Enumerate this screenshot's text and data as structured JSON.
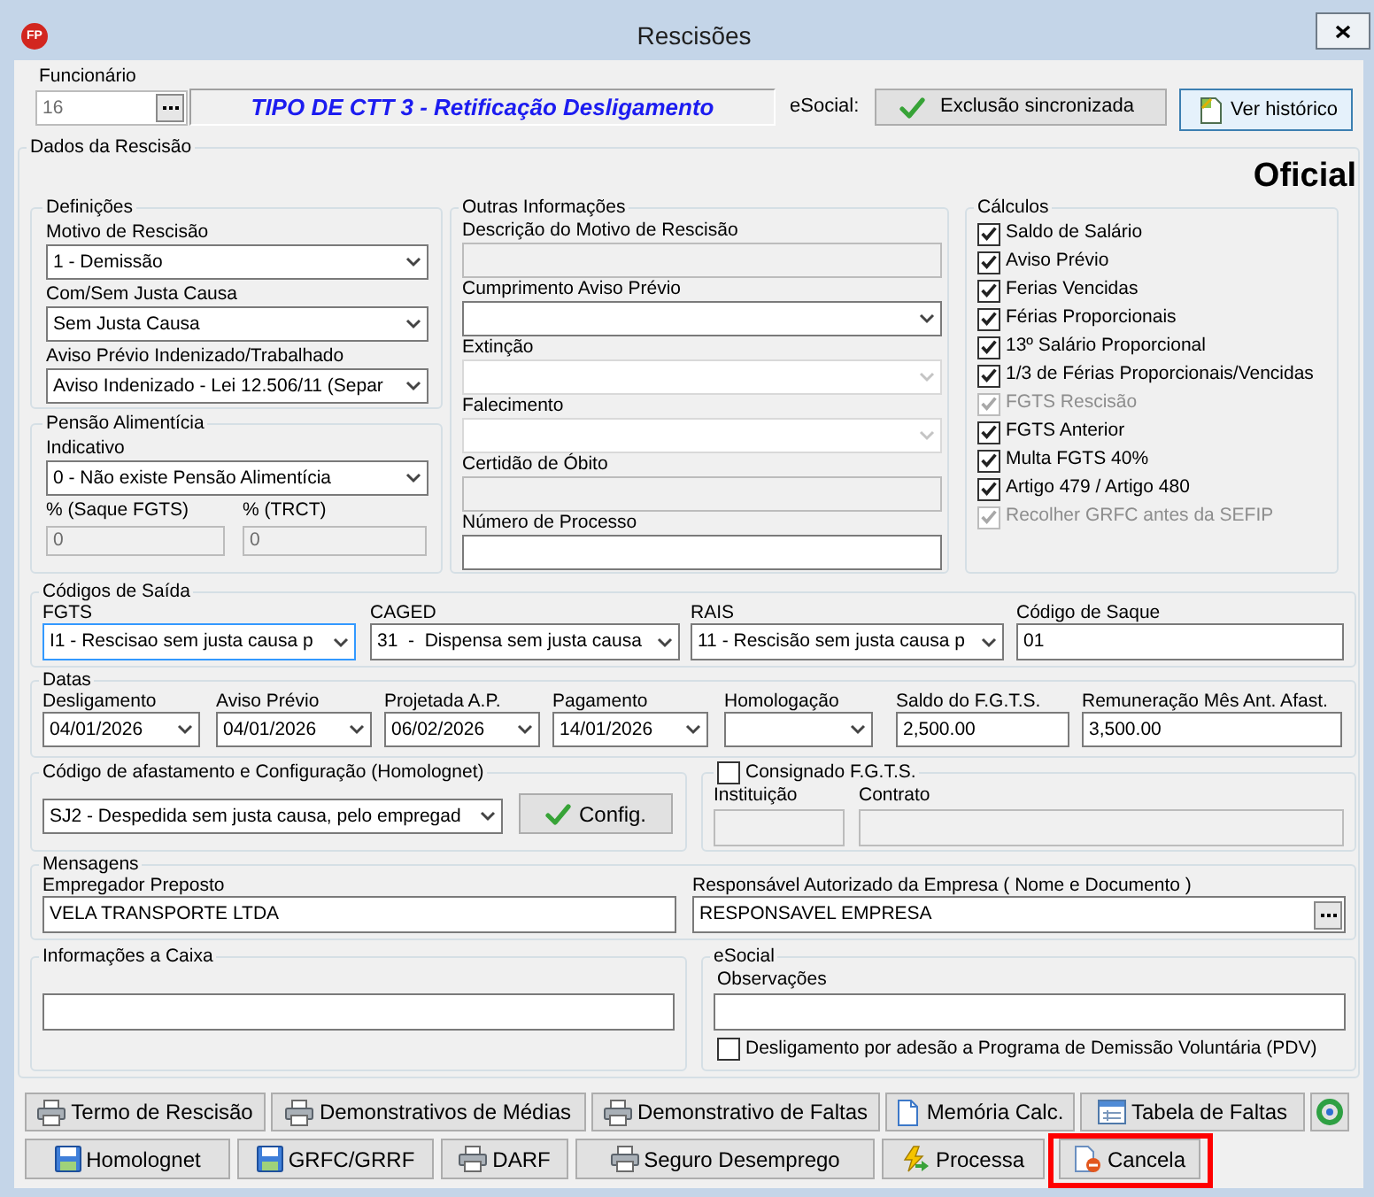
{
  "window": {
    "logo": "FP",
    "title": "Rescisões"
  },
  "employee": {
    "label": "Funcionário",
    "code": {
      "kind": "lookup",
      "value": "16",
      "disabled": true
    },
    "name": "TIPO DE CTT 3 - Retificação Desligamento"
  },
  "esocial_bar": {
    "label": "eSocial:",
    "buttons": [
      {
        "label": "Exclusão sincronizada",
        "focused": false
      },
      {
        "label": "Ver histórico",
        "focused": true
      }
    ]
  },
  "dados": {
    "title": "Dados da Rescisão",
    "status": "Oficial"
  },
  "definicoes": {
    "title": "Definições",
    "fields": [
      {
        "label": "Motivo de Rescisão",
        "kind": "select",
        "value": "1 - Demissão",
        "disabled": false
      },
      {
        "label": "Com/Sem Justa Causa",
        "kind": "select",
        "value": "Sem Justa Causa",
        "disabled": false
      },
      {
        "label": "Aviso Prévio Indenizado/Trabalhado",
        "kind": "select",
        "value": "Aviso Indenizado - Lei 12.506/11 (Separ",
        "disabled": false
      }
    ]
  },
  "pensao": {
    "title": "Pensão Alimentícia",
    "fields": [
      {
        "label": "Indicativo",
        "kind": "select",
        "value": "0 - Não existe Pensão Alimentícia",
        "disabled": false
      },
      {
        "label": "% (Saque FGTS)",
        "kind": "input",
        "value": "0",
        "disabled": true
      },
      {
        "label": "% (TRCT)",
        "kind": "input",
        "value": "0",
        "disabled": true
      }
    ]
  },
  "outras": {
    "title": "Outras Informações",
    "fields": [
      {
        "label": "Descrição do Motivo de Rescisão",
        "kind": "input",
        "disabled": true
      },
      {
        "label": "Cumprimento Aviso Prévio",
        "kind": "select",
        "disabled": false
      },
      {
        "label": "Extinção",
        "kind": "select",
        "disabled": true
      },
      {
        "label": "Falecimento",
        "kind": "select",
        "disabled": true
      },
      {
        "label": "Certidão de Óbito",
        "kind": "input",
        "disabled": true
      },
      {
        "label": "Número de Processo",
        "kind": "input",
        "disabled": false
      }
    ]
  },
  "calculos": {
    "title": "Cálculos",
    "items": [
      {
        "label": "Saldo de Salário",
        "checked": true,
        "disabled": false
      },
      {
        "label": "Aviso Prévio",
        "checked": true,
        "disabled": false
      },
      {
        "label": "Ferias Vencidas",
        "checked": true,
        "disabled": false
      },
      {
        "label": "Férias Proporcionais",
        "checked": true,
        "disabled": false
      },
      {
        "label": "13º Salário Proporcional",
        "checked": true,
        "disabled": false
      },
      {
        "label": "1/3 de Férias Proporcionais/Vencidas",
        "checked": true,
        "disabled": false
      },
      {
        "label": "FGTS Rescisão",
        "checked": true,
        "disabled": true
      },
      {
        "label": "FGTS Anterior",
        "checked": true,
        "disabled": false
      },
      {
        "label": "Multa FGTS 40%",
        "checked": true,
        "disabled": false
      },
      {
        "label": "Artigo 479 / Artigo 480",
        "checked": true,
        "disabled": false
      },
      {
        "label": "Recolher GRFC antes da SEFIP",
        "checked": true,
        "disabled": true
      }
    ]
  },
  "codigos_saida": {
    "title": "Códigos de Saída",
    "fields": [
      {
        "label": "FGTS",
        "kind": "select",
        "value": "I1 - Rescisao sem justa causa p",
        "focused": true
      },
      {
        "label": "CAGED",
        "kind": "select",
        "value": "31  -  Dispensa sem justa causa",
        "focused": false
      },
      {
        "label": "RAIS",
        "kind": "select",
        "value": "11 - Rescisão sem justa causa p",
        "focused": false
      },
      {
        "label": "Código de Saque",
        "kind": "input",
        "value": "01",
        "focused": false
      }
    ]
  },
  "datas": {
    "title": "Datas",
    "fields": [
      {
        "label": "Desligamento",
        "kind": "date",
        "value": "04/01/2026"
      },
      {
        "label": "Aviso Prévio",
        "kind": "date",
        "value": "04/01/2026"
      },
      {
        "label": "Projetada A.P.",
        "kind": "date",
        "value": "06/02/2026"
      },
      {
        "label": "Pagamento",
        "kind": "date",
        "value": "14/01/2026"
      },
      {
        "label": "Homologação",
        "kind": "date"
      },
      {
        "label": "Saldo do F.G.T.S.",
        "kind": "input",
        "value": "2,500.00"
      },
      {
        "label": "Remuneração Mês Ant. Afast.",
        "kind": "input",
        "value": "3,500.00"
      }
    ]
  },
  "afastamento": {
    "title": "Código de afastamento e Configuração (Homolognet)",
    "field": {
      "kind": "select",
      "value": "SJ2 - Despedida sem justa causa, pelo empregad"
    },
    "button": "Config."
  },
  "consignado": {
    "label": "Consignado F.G.T.S.",
    "checked": false,
    "fields": [
      {
        "label": "Instituição",
        "kind": "input",
        "disabled": true
      },
      {
        "label": "Contrato",
        "kind": "input",
        "disabled": true
      }
    ]
  },
  "mensagens": {
    "title": "Mensagens",
    "fields": [
      {
        "label": "Empregador Preposto",
        "kind": "input",
        "value": "VELA TRANSPORTE LTDA"
      },
      {
        "label": "Responsável Autorizado da Empresa ( Nome e Documento )",
        "kind": "lookup",
        "value": "RESPONSAVEL EMPRESA"
      }
    ]
  },
  "informacoes_caixa": {
    "title": "Informações a Caixa",
    "field": {
      "kind": "input"
    }
  },
  "esocial": {
    "title": "eSocial",
    "field": {
      "label": "Observações",
      "kind": "input"
    },
    "pdv": {
      "label": "Desligamento por adesão a Programa de Demissão Voluntária (PDV)",
      "checked": false
    }
  },
  "buttons_row1": [
    {
      "label": "Termo de Rescisão",
      "highlighted": false
    },
    {
      "label": "Demonstrativos de Médias",
      "highlighted": false
    },
    {
      "label": "Demonstrativo de Faltas",
      "highlighted": false
    },
    {
      "label": "Memória Calc.",
      "highlighted": false
    },
    {
      "label": "Tabela de Faltas",
      "highlighted": false
    }
  ],
  "buttons_row2": [
    {
      "label": "Homolognet",
      "highlighted": false
    },
    {
      "label": "GRFC/GRRF",
      "highlighted": false
    },
    {
      "label": "DARF",
      "highlighted": false
    },
    {
      "label": "Seguro Desemprego",
      "highlighted": false
    },
    {
      "label": "Processa",
      "highlighted": false
    },
    {
      "label": "Cancela",
      "highlighted": true
    }
  ]
}
